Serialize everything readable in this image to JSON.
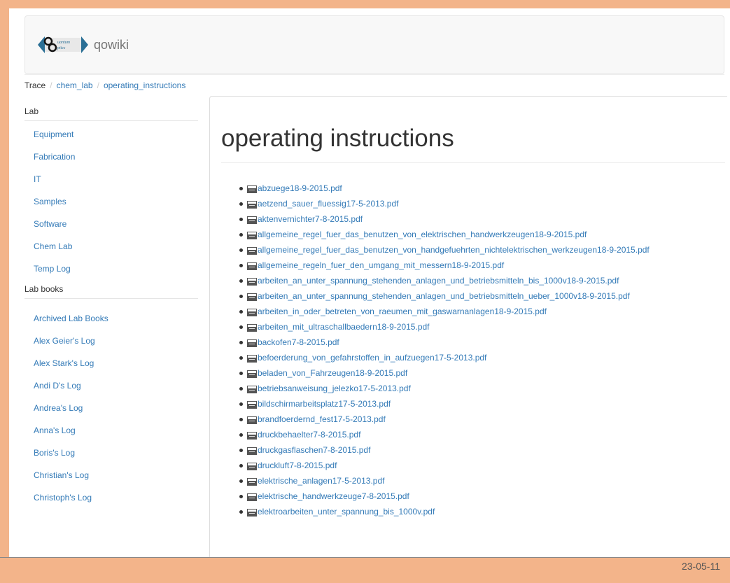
{
  "site": {
    "brand": "qowiki",
    "logo_text": "quantum optics"
  },
  "breadcrumb": {
    "trace": "Trace",
    "sep": "/",
    "items": [
      "chem_lab",
      "operating_instructions"
    ]
  },
  "sidebar": {
    "lab_heading": "Lab",
    "lab_items": [
      "Equipment",
      "Fabrication",
      "IT",
      "Samples",
      "Software",
      "Chem Lab",
      "Temp Log"
    ],
    "books_heading": "Lab books",
    "book_items": [
      "Archived Lab Books",
      "Alex Geier's Log",
      "Alex Stark's Log",
      "Andi D's Log",
      "Andrea's Log",
      "Anna's Log",
      "Boris's Log",
      "Christian's Log",
      "Christoph's Log"
    ]
  },
  "main": {
    "title": "operating instructions",
    "files": [
      "abzuege18-9-2015.pdf",
      "aetzend_sauer_fluessig17-5-2013.pdf",
      "aktenvernichter7-8-2015.pdf",
      "allgemeine_regel_fuer_das_benutzen_von_elektrischen_handwerkzeugen18-9-2015.pdf",
      "allgemeine_regel_fuer_das_benutzen_von_handgefuehrten_nichtelektrischen_werkzeugen18-9-2015.pdf",
      "allgemeine_regeln_fuer_den_umgang_mit_messern18-9-2015.pdf",
      "arbeiten_an_unter_spannung_stehenden_anlagen_und_betriebsmitteln_bis_1000v18-9-2015.pdf",
      "arbeiten_an_unter_spannung_stehenden_anlagen_und_betriebsmitteln_ueber_1000v18-9-2015.pdf",
      "arbeiten_in_oder_betreten_von_raeumen_mit_gaswarnanlagen18-9-2015.pdf",
      "arbeiten_mit_ultraschallbaedern18-9-2015.pdf",
      "backofen7-8-2015.pdf",
      "befoerderung_von_gefahrstoffen_in_aufzuegen17-5-2013.pdf",
      "beladen_von_Fahrzeugen18-9-2015.pdf",
      "betriebsanweisung_jelezko17-5-2013.pdf",
      "bildschirmarbeitsplatz17-5-2013.pdf",
      "brandfoerdernd_fest17-5-2013.pdf",
      "druckbehaelter7-8-2015.pdf",
      "druckgasflaschen7-8-2015.pdf",
      "druckluft7-8-2015.pdf",
      "elektrische_anlagen17-5-2013.pdf",
      "elektrische_handwerkzeuge7-8-2015.pdf",
      "elektroarbeiten_unter_spannung_bis_1000v.pdf"
    ]
  },
  "footer": {
    "date": "23-05-11"
  },
  "colors": {
    "frame": "#f3b48a",
    "link": "#337ab7",
    "text": "#333333"
  }
}
